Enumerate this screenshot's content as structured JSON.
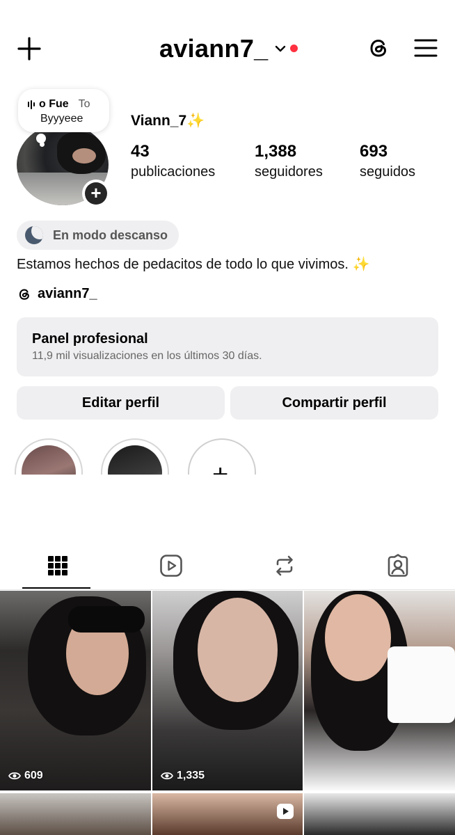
{
  "header": {
    "username": "aviann7_",
    "has_unread": true,
    "unread_color": "#ff3040"
  },
  "note": {
    "song_title": "o Fue",
    "song_more": "To",
    "text": "Byyyeee"
  },
  "profile": {
    "display_name": "Viann_7",
    "name_emoji": "✨",
    "stats": {
      "posts_count": "43",
      "posts_label": "publicaciones",
      "followers_count": "1,388",
      "followers_label": "seguidores",
      "following_count": "693",
      "following_label": "seguidos"
    },
    "rest_mode": "En modo descanso",
    "bio": "Estamos hechos de pedacitos de todo lo que vivimos.",
    "bio_emoji": "✨",
    "threads_handle": "aviann7_"
  },
  "panel": {
    "title": "Panel profesional",
    "subtitle": "11,9 mil visualizaciones en los últimos 30 días."
  },
  "buttons": {
    "edit": "Editar perfil",
    "share": "Compartir perfil"
  },
  "highlights": {
    "new_symbol": "+"
  },
  "tabs": {
    "icons": [
      "grid-icon",
      "reels-icon",
      "reposts-icon",
      "tagged-icon"
    ],
    "active": "grid"
  },
  "posts": [
    {
      "views": "609"
    },
    {
      "views": "1,335"
    },
    {
      "views": ""
    }
  ]
}
